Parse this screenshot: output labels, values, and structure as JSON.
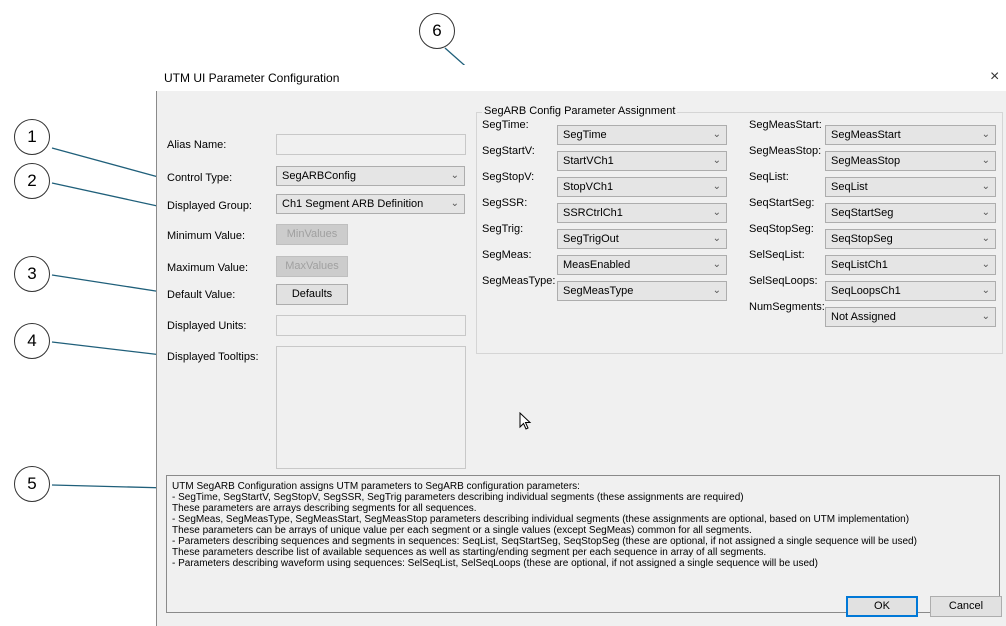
{
  "dialog": {
    "title": "UTM UI Parameter Configuration",
    "close_icon": "×"
  },
  "left": {
    "alias_name_label": "Alias Name:",
    "alias_name_value": "",
    "control_type_label": "Control Type:",
    "control_type_value": "SegARBConfig",
    "displayed_group_label": "Displayed Group:",
    "displayed_group_value": "Ch1 Segment ARB Definition",
    "minimum_value_label": "Minimum Value:",
    "min_values_button": "MinValues",
    "maximum_value_label": "Maximum Value:",
    "max_values_button": "MaxValues",
    "default_value_label": "Default Value:",
    "defaults_button": "Defaults",
    "displayed_units_label": "Displayed Units:",
    "displayed_tooltips_label": "Displayed Tooltips:"
  },
  "group": {
    "title": "SegARB Config Parameter Assignment",
    "left_col": [
      {
        "label": "SegTime:",
        "value": "SegTime"
      },
      {
        "label": "SegStartV:",
        "value": "StartVCh1"
      },
      {
        "label": "SegStopV:",
        "value": "StopVCh1"
      },
      {
        "label": "SegSSR:",
        "value": "SSRCtrlCh1"
      },
      {
        "label": "SegTrig:",
        "value": "SegTrigOut"
      },
      {
        "label": "SegMeas:",
        "value": "MeasEnabled"
      },
      {
        "label": "SegMeasType:",
        "value": "SegMeasType"
      }
    ],
    "right_col": [
      {
        "label": "SegMeasStart:",
        "value": "SegMeasStart"
      },
      {
        "label": "SegMeasStop:",
        "value": "SegMeasStop"
      },
      {
        "label": "SeqList:",
        "value": "SeqList"
      },
      {
        "label": "SeqStartSeg:",
        "value": "SeqStartSeg"
      },
      {
        "label": "SeqStopSeg:",
        "value": "SeqStopSeg"
      },
      {
        "label": "SelSeqList:",
        "value": "SeqListCh1"
      },
      {
        "label": "SelSeqLoops:",
        "value": "SeqLoopsCh1"
      },
      {
        "label": "NumSegments:",
        "value": "Not Assigned"
      }
    ]
  },
  "info_lines": [
    "UTM SegARB Configuration assigns UTM parameters to SegARB configuration parameters:",
    "- SegTime, SegStartV, SegStopV, SegSSR, SegTrig parameters describing individual segments (these assignments are required)",
    "   These parameters are arrays describing segments for all sequences.",
    "- SegMeas, SegMeasType, SegMeasStart, SegMeasStop parameters describing individual segments (these assignments are optional, based on UTM implementation)",
    "   These parameters can be arrays of unique value per each segment or a single values (except SegMeas) common for all segments.",
    "- Parameters describing sequences and segments in sequences: SeqList, SeqStartSeg, SeqStopSeg (these are optional, if not assigned a single sequence will be used)",
    "   These parameters describe list of available sequences as well as starting/ending segment per each sequence in array of all segments.",
    "- Parameters describing waveform using sequences: SelSeqList, SelSeqLoops (these are optional, if not assigned a single sequence will be used)"
  ],
  "buttons": {
    "ok": "OK",
    "cancel": "Cancel"
  },
  "callouts": [
    "1",
    "2",
    "3",
    "4",
    "5",
    "6"
  ],
  "icons": {
    "combo_arrow": "chevron-down-icon",
    "cursor": "mouse-pointer-icon"
  }
}
